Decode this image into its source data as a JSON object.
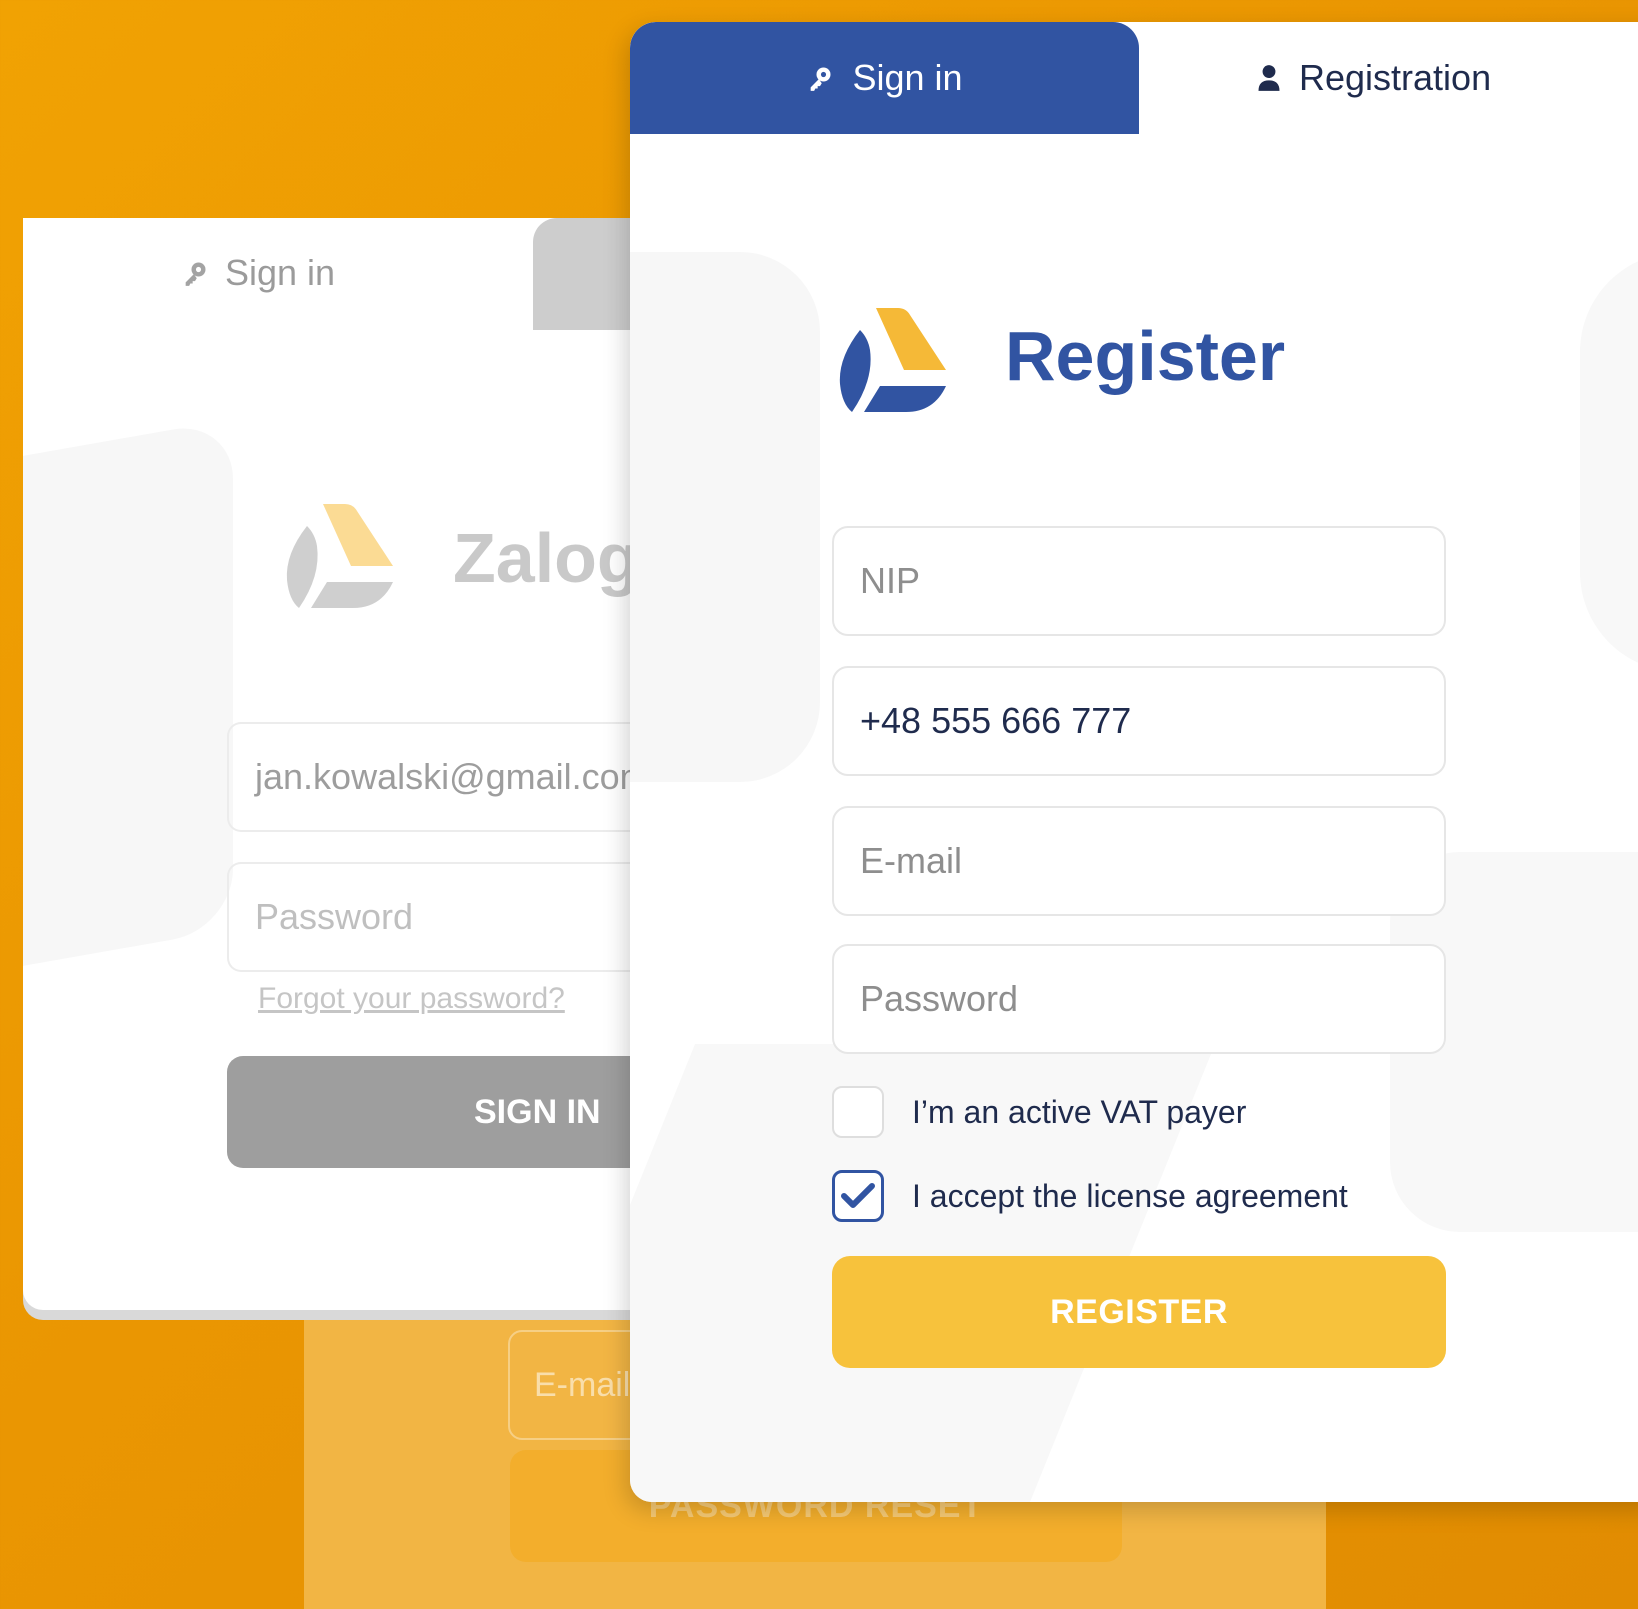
{
  "password_reset": {
    "email_placeholder": "E-mail",
    "button_label": "PASSWORD RESET"
  },
  "signin_panel": {
    "tab_label": "Sign in",
    "title": "Zalog",
    "email_value": "jan.kowalski@gmail.com",
    "password_placeholder": "Password",
    "forgot_link": "Forgot your password?",
    "button_label": "SIGN IN"
  },
  "registration": {
    "tabs": [
      {
        "label": "Sign in",
        "icon": "key-icon",
        "active": true
      },
      {
        "label": "Registration",
        "icon": "user-icon",
        "active": false
      }
    ],
    "title": "Register",
    "fields": {
      "nip_placeholder": "NIP",
      "phone_value": "+48 555 666 777",
      "email_placeholder": "E-mail",
      "password_placeholder": "Password"
    },
    "checkboxes": {
      "vat_label": "I’m an active VAT payer",
      "vat_checked": false,
      "license_label": "I accept the license agreement",
      "license_checked": true
    },
    "button_label": "REGISTER"
  },
  "colors": {
    "primary_blue": "#3154a2",
    "accent_yellow": "#f7c23c",
    "background_orange": "#ea9602",
    "logo_yellow": "#f5b937"
  }
}
